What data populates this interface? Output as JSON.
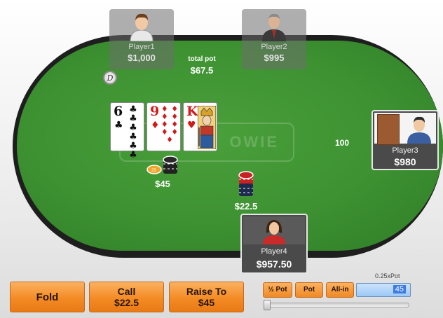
{
  "pot": {
    "label": "total pot",
    "value": "$67.5"
  },
  "logo": {
    "text": "OWIE"
  },
  "dealer_button": {
    "symbol": "D"
  },
  "players": [
    {
      "name": "Player1",
      "stack": "$1,000"
    },
    {
      "name": "Player2",
      "stack": "$995"
    },
    {
      "name": "Player3",
      "stack": "$980",
      "bet": "100"
    },
    {
      "name": "Player4",
      "stack": "$957.50",
      "bet": "$22.5"
    }
  ],
  "left_bet": "$45",
  "board": [
    {
      "rank": "6",
      "suit": "♣",
      "color": "#111111",
      "pips": "♣ ♣ ♣ ♣ ♣ ♣"
    },
    {
      "rank": "9",
      "suit": "♦",
      "color": "#d11a1a",
      "pips": "♦ ♦ ♦ ♦ ♦ ♦ ♦ ♦ ♦"
    },
    {
      "rank": "K",
      "suit": "♥",
      "color": "#d11a1a",
      "pips": ""
    }
  ],
  "actions": {
    "fold": {
      "line1": "Fold"
    },
    "call": {
      "line1": "Call",
      "line2": "$22.5"
    },
    "raise": {
      "line1": "Raise To",
      "line2": "$45"
    }
  },
  "bet_controls": {
    "half_pot": "½ Pot",
    "pot": "Pot",
    "all_in": "All-in",
    "ratio_label": "0.25xPot",
    "bet_value": "45",
    "slider_position": 0
  },
  "colors": {
    "felt": "#3d9131",
    "button_orange": "#f38b25",
    "input_blue": "#3d7be0"
  }
}
